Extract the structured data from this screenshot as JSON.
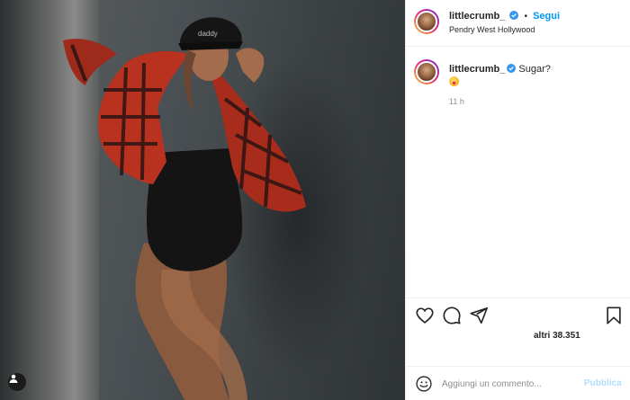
{
  "post": {
    "author": "littlecrumb_",
    "follow_label": "Segui",
    "separator": "•",
    "location": "Pendry West Hollywood",
    "photo_alt": "Photo of a woman in a black cap, red plaid jacket and black bodysuit"
  },
  "caption": {
    "username": "littlecrumb_",
    "text": "Sugar?",
    "emoji": "tongue-out-emoji",
    "time": "11 h"
  },
  "actions": {
    "like_icon": "heart-icon",
    "comment_icon": "comment-icon",
    "share_icon": "send-icon",
    "save_icon": "bookmark-icon"
  },
  "likes": {
    "text": "altri 38.351"
  },
  "add_comment": {
    "placeholder": "Aggiungi un commento...",
    "publish_label": "Pubblica"
  },
  "colors": {
    "accent": "#0095f6",
    "publish_disabled": "#b2dffc",
    "text": "#262626",
    "muted": "#8e8e8e"
  }
}
